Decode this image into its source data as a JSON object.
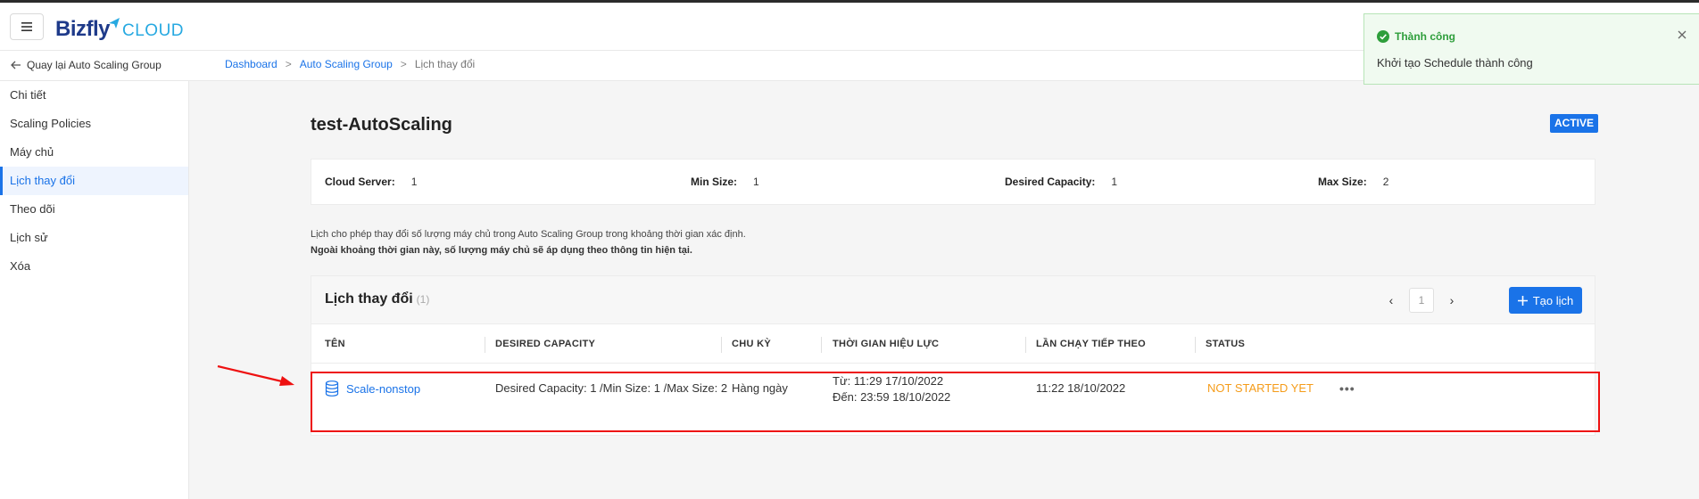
{
  "header": {
    "logo_text": "Bizfly",
    "logo_suffix": "CLOUD",
    "menu_icon": "hamburger-menu-icon"
  },
  "subbar": {
    "back_label": "Quay lại Auto Scaling Group",
    "breadcrumb": {
      "dashboard": "Dashboard",
      "asg": "Auto Scaling Group",
      "current": "Lịch thay đổi",
      "separator": ">"
    }
  },
  "sidebar": {
    "items": [
      {
        "label": "Chi tiết"
      },
      {
        "label": "Scaling Policies"
      },
      {
        "label": "Máy chủ"
      },
      {
        "label": "Lịch thay đổi"
      },
      {
        "label": "Theo dõi"
      },
      {
        "label": "Lịch sử"
      },
      {
        "label": "Xóa"
      }
    ],
    "active_index": 3
  },
  "page": {
    "title": "test-AutoScaling",
    "status_badge": "ACTIVE"
  },
  "info": {
    "cloud_server_label": "Cloud Server:",
    "cloud_server_value": "1",
    "min_size_label": "Min Size:",
    "min_size_value": "1",
    "desired_label": "Desired Capacity:",
    "desired_value": "1",
    "max_size_label": "Max Size:",
    "max_size_value": "2"
  },
  "description": {
    "line1": "Lịch cho phép thay đổi số lượng máy chủ trong Auto Scaling Group trong khoảng thời gian xác định.",
    "line2": "Ngoài khoảng thời gian này, số lượng máy chủ sẽ áp dụng theo thông tin hiện tại."
  },
  "table": {
    "title": "Lịch thay đổi",
    "count": "(1)",
    "pager": {
      "prev": "‹",
      "page": "1",
      "next": "›"
    },
    "create_button": "Tạo lịch",
    "columns": {
      "name": "TÊN",
      "desired": "DESIRED CAPACITY",
      "cycle": "CHU KỲ",
      "effective": "THỜI GIAN HIỆU LỰC",
      "next_run": "LẦN CHẠY TIẾP THEO",
      "status": "STATUS"
    },
    "rows": [
      {
        "name": "Scale-nonstop",
        "desired": "Desired Capacity: 1 /Min Size: 1 /Max Size: 2",
        "cycle": "Hàng ngày",
        "from": "Từ: 11:29 17/10/2022",
        "to": "Đến: 23:59 18/10/2022",
        "next_run": "11:22 18/10/2022",
        "status": "NOT STARTED YET",
        "actions": "•••"
      }
    ]
  },
  "toast": {
    "title": "Thành công",
    "message": "Khởi tạo Schedule thành công"
  },
  "colors": {
    "primary": "#1a73e8",
    "success": "#2e9e3b",
    "warning": "#f59c1a",
    "annotation_red": "#e11"
  }
}
